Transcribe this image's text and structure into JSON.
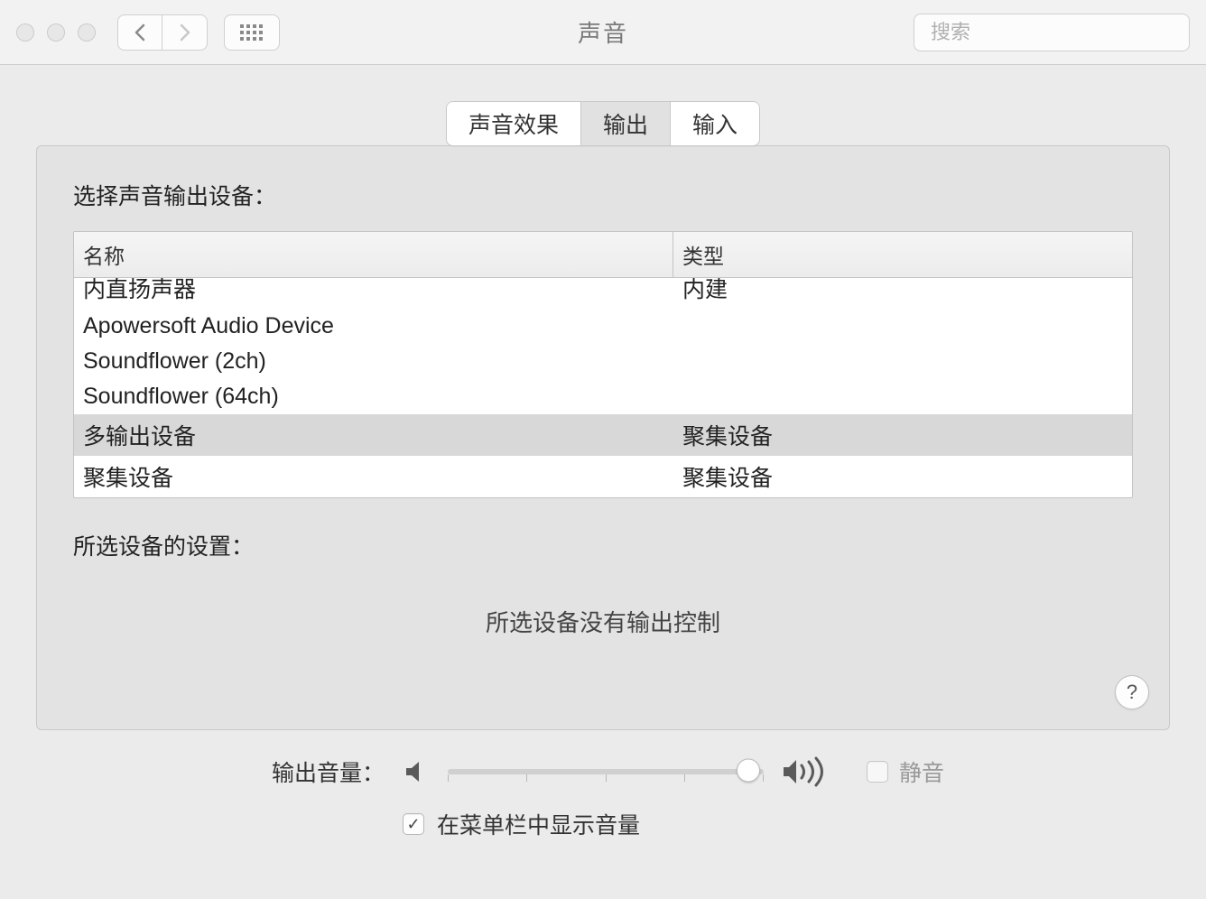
{
  "window": {
    "title": "声音"
  },
  "search": {
    "placeholder": "搜索",
    "value": ""
  },
  "tabs": [
    {
      "label": "声音效果",
      "active": false
    },
    {
      "label": "输出",
      "active": true
    },
    {
      "label": "输入",
      "active": false
    }
  ],
  "output": {
    "select_label": "选择声音输出设备：",
    "columns": {
      "name": "名称",
      "type": "类型"
    },
    "devices": [
      {
        "name": "内直扬声器",
        "type": "内建",
        "selected": false
      },
      {
        "name": "Apowersoft Audio Device",
        "type": "",
        "selected": false
      },
      {
        "name": "Soundflower (2ch)",
        "type": "",
        "selected": false
      },
      {
        "name": "Soundflower (64ch)",
        "type": "",
        "selected": false
      },
      {
        "name": "多输出设备",
        "type": "聚集设备",
        "selected": true
      },
      {
        "name": "聚集设备",
        "type": "聚集设备",
        "selected": false
      }
    ],
    "settings_label": "所选设备的设置：",
    "no_controls_msg": "所选设备没有输出控制"
  },
  "volume": {
    "label": "输出音量：",
    "value_percent": 95,
    "mute_label": "静音",
    "mute_checked": false,
    "mute_enabled": false,
    "show_in_menubar_label": "在菜单栏中显示音量",
    "show_in_menubar_checked": true
  },
  "icons": {
    "help": "?",
    "check": "✓"
  }
}
